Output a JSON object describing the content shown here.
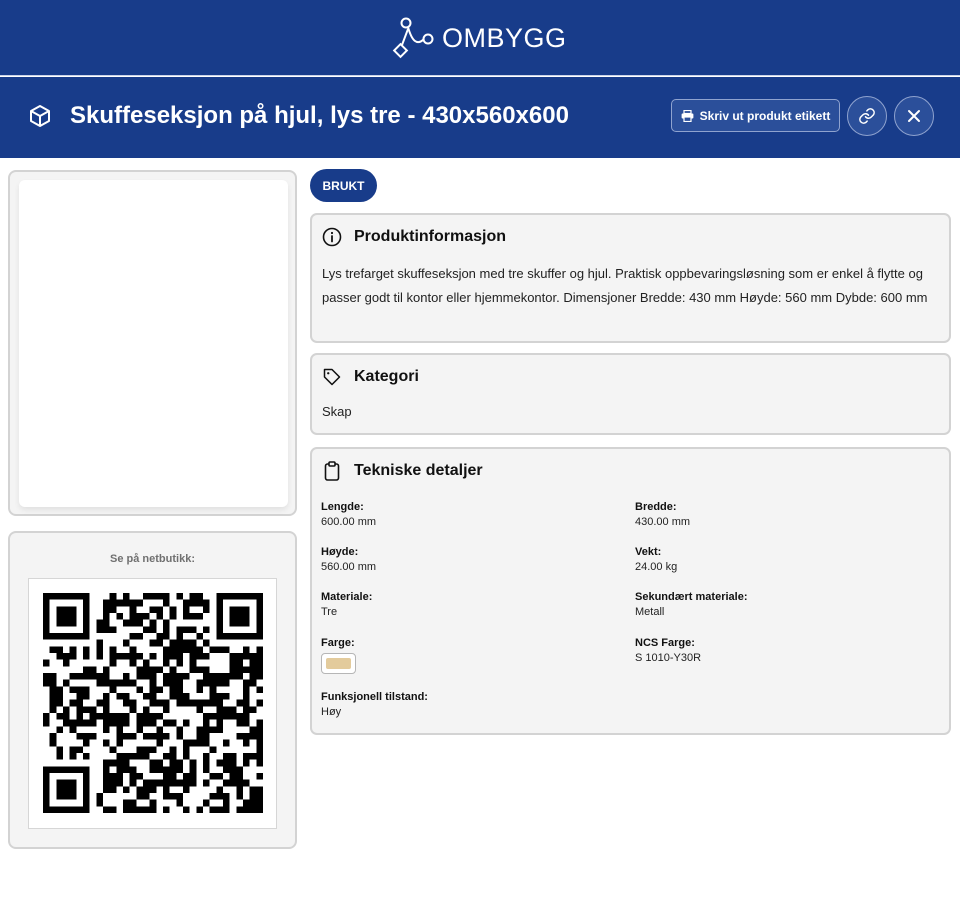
{
  "brand": {
    "name": "OMBYGG"
  },
  "header": {
    "title": "Skuffeseksjon på hjul, lys tre - 430x560x600",
    "print_label": "Skriv ut produkt etikett"
  },
  "qr": {
    "label": "Se på netbutikk:"
  },
  "badge": "BRUKT",
  "info": {
    "title": "Produktinformasjon",
    "text": "Lys trefarget skuffeseksjon med tre skuffer og hjul. Praktisk oppbevaringsløsning som er enkel å flytte og passer godt til kontor eller hjemmekontor. Dimensjoner Bredde: 430 mm Høyde: 560 mm Dybde: 600 mm"
  },
  "category": {
    "title": "Kategori",
    "value": "Skap"
  },
  "tech": {
    "title": "Tekniske detaljer",
    "fields": {
      "lengde": {
        "label": "Lengde:",
        "value": "600.00 mm"
      },
      "bredde": {
        "label": "Bredde:",
        "value": "430.00 mm"
      },
      "hoyde": {
        "label": "Høyde:",
        "value": "560.00 mm"
      },
      "vekt": {
        "label": "Vekt:",
        "value": "24.00 kg"
      },
      "materiale": {
        "label": "Materiale:",
        "value": "Tre"
      },
      "sekundaert": {
        "label": "Sekundært materiale:",
        "value": "Metall"
      },
      "farge": {
        "label": "Farge:",
        "swatch_color": "#e3cb9c"
      },
      "ncs": {
        "label": "NCS Farge:",
        "value": "S 1010-Y30R"
      },
      "tilstand": {
        "label": "Funksjonell tilstand:",
        "value": "Høy"
      }
    }
  },
  "colors": {
    "primary": "#183c8a",
    "panel_bg": "#f4f4f4",
    "border": "#d3d3d3"
  }
}
